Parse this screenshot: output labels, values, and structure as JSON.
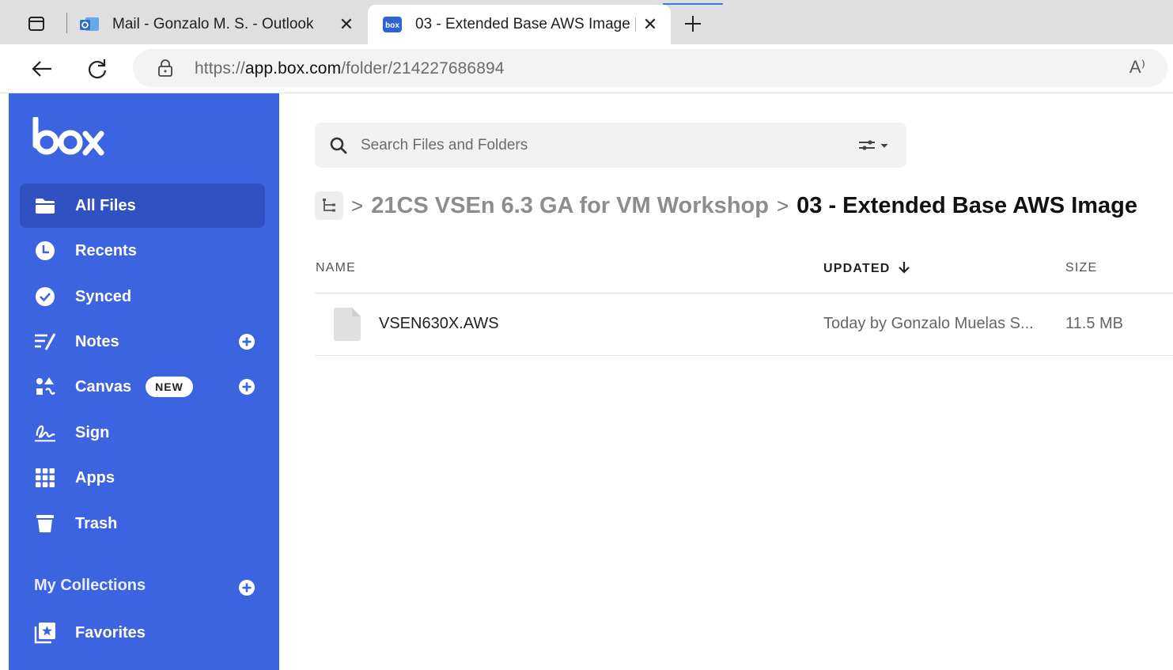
{
  "browser": {
    "tabs": [
      {
        "title": "Mail - Gonzalo M. S. - Outlook",
        "icon": "outlook-icon",
        "active": false
      },
      {
        "title": "03 - Extended Base AWS Image |",
        "icon": "box-favicon",
        "active": true
      }
    ],
    "close_glyph": "✕",
    "url_scheme": "https://",
    "url_host": "app.box.com",
    "url_path": "/folder/214227686894",
    "read_aloud_glyph": "A⁾"
  },
  "sidebar": {
    "logo": "box",
    "items": [
      {
        "label": "All Files",
        "icon": "folder-icon"
      },
      {
        "label": "Recents",
        "icon": "clock-icon"
      },
      {
        "label": "Synced",
        "icon": "check-circle-icon"
      },
      {
        "label": "Notes",
        "icon": "notes-icon"
      },
      {
        "label": "Canvas",
        "icon": "canvas-icon",
        "badge": "NEW"
      },
      {
        "label": "Sign",
        "icon": "signature-icon"
      },
      {
        "label": "Apps",
        "icon": "grid-icon"
      },
      {
        "label": "Trash",
        "icon": "trash-icon"
      }
    ],
    "collections_title": "My Collections",
    "favorites_label": "Favorites"
  },
  "search": {
    "placeholder": "Search Files and Folders"
  },
  "breadcrumb": {
    "parent": "21CS VSEn 6.3 GA for VM Workshop",
    "current": "03 - Extended Base AWS Image",
    "separator": ">"
  },
  "table": {
    "headers": {
      "name": "NAME",
      "updated": "UPDATED",
      "size": "SIZE"
    },
    "rows": [
      {
        "name": "VSEN630X.AWS",
        "updated": "Today by Gonzalo Muelas S...",
        "size": "11.5 MB"
      }
    ]
  },
  "colors": {
    "sidebar": "#3c64e0",
    "sidebar_selected": "#2f51c2",
    "box_blue": "#0061d5"
  }
}
